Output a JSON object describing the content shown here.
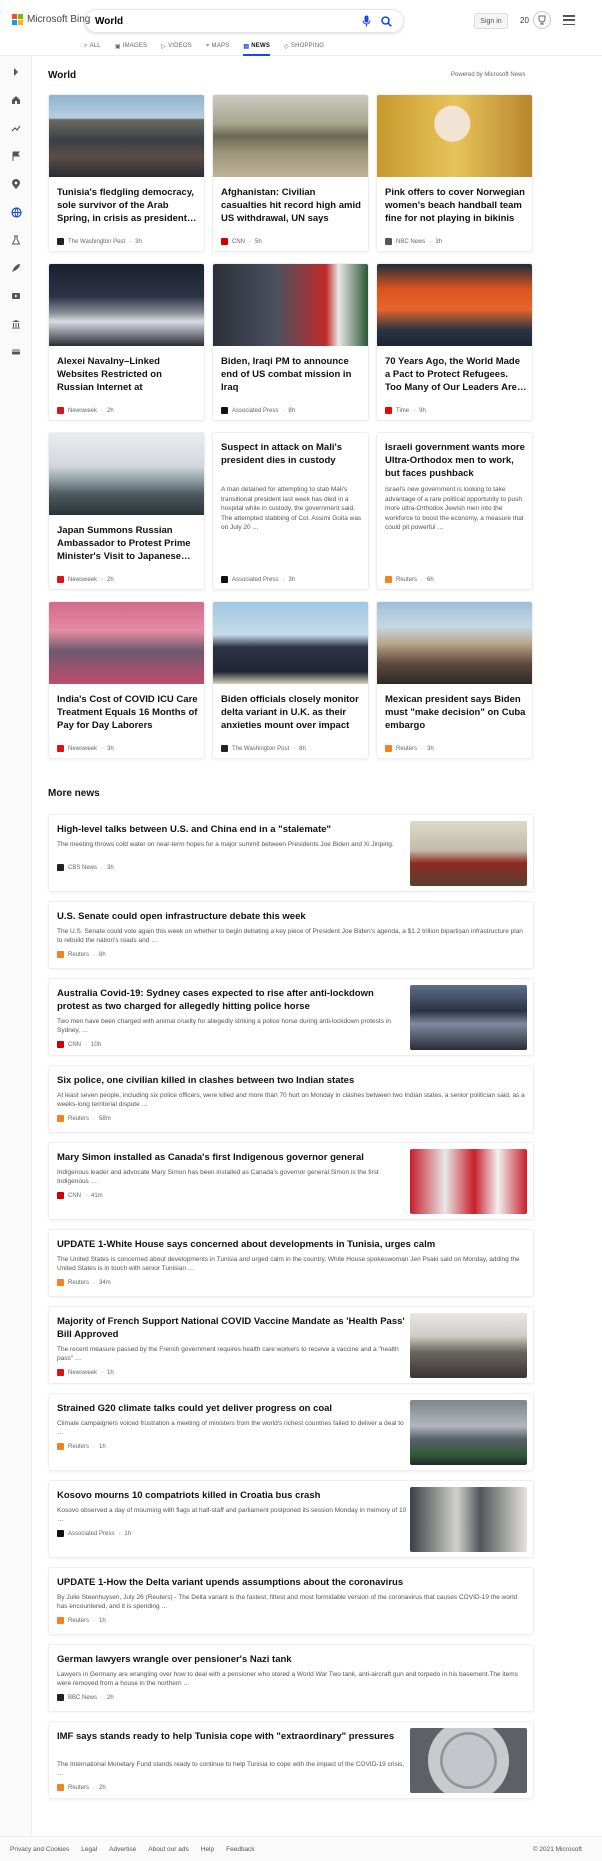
{
  "header": {
    "brand": "Microsoft Bing",
    "search_value": "World",
    "signin": "Sign in",
    "rewards_count": "20"
  },
  "scopes": [
    {
      "label": "ALL",
      "icon": "search-icon"
    },
    {
      "label": "IMAGES",
      "icon": "image-icon"
    },
    {
      "label": "VIDEOS",
      "icon": "video-icon"
    },
    {
      "label": "MAPS",
      "icon": "map-pin-icon"
    },
    {
      "label": "NEWS",
      "icon": "news-icon"
    },
    {
      "label": "SHOPPING",
      "icon": "tag-icon"
    }
  ],
  "sidebar_icons": [
    "expand-icon",
    "home-icon",
    "trending-icon",
    "flag-icon",
    "location-icon",
    "globe-icon",
    "science-icon",
    "rocket-icon",
    "entertainment-icon",
    "government-icon",
    "money-icon"
  ],
  "page": {
    "title": "World",
    "powered_by": "Powered by Microsoft News"
  },
  "cards": [
    {
      "title": "Tunisia's fledgling democracy, sole survivor of the Arab Spring, in crisis as president…",
      "source": "The Washington Post",
      "age": "3h",
      "logo_color": "#222",
      "scene": "crowd"
    },
    {
      "title": "Afghanistan: Civilian casualties hit record high amid US withdrawal, UN says",
      "source": "CNN",
      "age": "5h",
      "logo_color": "#cc0000",
      "scene": "military"
    },
    {
      "title": "Pink offers to cover Norwegian women's beach handball team fine for not playing in bikinis",
      "source": "NBC News",
      "age": "3h",
      "logo_color": "#555",
      "scene": "portrait-gold"
    },
    {
      "title": "Alexei Navalny–Linked Websites Restricted on Russian Internet at Government's…",
      "source": "Newsweek",
      "age": "2h",
      "logo_color": "#d7141a",
      "scene": "protest"
    },
    {
      "title": "Biden, Iraqi PM to announce end of US combat mission in Iraq",
      "source": "Associated Press",
      "age": "8h",
      "logo_color": "#111",
      "scene": "official"
    },
    {
      "title": "70 Years Ago, the World Made a Pact to Protect Refugees. Too Many of Our Leaders Are…",
      "source": "Time",
      "age": "9h",
      "logo_color": "#e90606",
      "scene": "boat"
    },
    {
      "title": "Japan Summons Russian Ambassador to Protest Prime Minister's Visit to Japanese…",
      "source": "Newsweek",
      "age": "2h",
      "logo_color": "#d7141a",
      "scene": "train"
    },
    {
      "title": "Suspect in attack on Mali's president dies in custody",
      "snippet": "A man detained for attempting to stab Mali's transitional president last week has died in a hospital while in custody, the government said. The attempted stabbing of Col. Assimi Goita was on July 20 …",
      "source": "Associated Press",
      "age": "3h",
      "logo_color": "#111",
      "scene": ""
    },
    {
      "title": "Israeli government wants more Ultra-Orthodox men to work, but faces pushback",
      "snippet": "Israel's new government is looking to take advantage of a rare political opportunity to push more ultra-Orthodox Jewish men into the workforce to boost the economy, a measure that could pit powerful …",
      "source": "Reuters",
      "age": "6h",
      "logo_color": "#f58220",
      "scene": ""
    },
    {
      "title": "India's Cost of COVID ICU Care Treatment Equals 16 Months of Pay for Day Laborers",
      "source": "Newsweek",
      "age": "3h",
      "logo_color": "#d7141a",
      "scene": "hospital"
    },
    {
      "title": "Biden officials closely monitor delta variant in U.K. as their anxieties mount over impact t…",
      "source": "The Washington Post",
      "age": "8h",
      "logo_color": "#222",
      "scene": "leaders"
    },
    {
      "title": "Mexican president says Biden must \"make decision\" on Cuba embargo",
      "source": "Reuters",
      "age": "3h",
      "logo_color": "#f58220",
      "scene": "plaza"
    }
  ],
  "more_news": {
    "heading": "More news",
    "items": [
      {
        "title": "High-level talks between U.S. and China end in a \"stalemate\"",
        "snippet": "The meeting throws cold water on near-term hopes for a major summit between Presidents Joe Biden and Xi Jinping.",
        "source": "CBS News",
        "age": "3h",
        "logo_color": "#222",
        "has_image": true,
        "scene": "meeting-room"
      },
      {
        "title": "U.S. Senate could open infrastructure debate this week",
        "snippet": "The U.S. Senate could vote again this week on whether to begin debating a key piece of President Joe Biden's agenda, a $1.2 trillion bipartisan infrastructure plan to rebuild the nation's roads and …",
        "source": "Reuters",
        "age": "8h",
        "logo_color": "#f58220",
        "has_image": false
      },
      {
        "title": "Australia Covid-19: Sydney cases expected to rise after anti-lockdown protest as two charged for allegedly hitting police horse",
        "snippet": "Two men have been charged with animal cruelty for allegedly striking a police horse during anti-lockdown protests in Sydney, …",
        "source": "CNN",
        "age": "10h",
        "logo_color": "#cc0000",
        "has_image": true,
        "scene": "street-protest"
      },
      {
        "title": "Six police, one civilian killed in clashes between two Indian states",
        "snippet": "At least seven people, including six police officers, were killed and more than 70 hurt on Monday in clashes between two Indian states, a senior politician said, as a weeks-long territorial dispute …",
        "source": "Reuters",
        "age": "58m",
        "logo_color": "#f58220",
        "has_image": false
      },
      {
        "title": "Mary Simon installed as Canada's first Indigenous governor general",
        "snippet": "Indigenous leader and advocate Mary Simon has been installed as Canada's governor general.Simon is the first Indigenous …",
        "source": "CNN",
        "age": "41m",
        "logo_color": "#cc0000",
        "has_image": true,
        "scene": "canada"
      },
      {
        "title": "UPDATE 1-White House says concerned about developments in Tunisia, urges calm",
        "snippet": "The United States is concerned about developments in Tunisia and urged calm in the country, White House spokeswoman Jen Psaki said on Monday, adding the United States is in touch with senior Tunisian …",
        "source": "Reuters",
        "age": "34m",
        "logo_color": "#f58220",
        "has_image": false
      },
      {
        "title": "Majority of French Support National COVID Vaccine Mandate as 'Health Pass' Bill Approved",
        "snippet": "The recent measure passed by the French government requires health care workers to receive a vaccine and a \"health pass\" …",
        "source": "Newsweek",
        "age": "1h",
        "logo_color": "#d7141a",
        "has_image": true,
        "scene": "french-protest"
      },
      {
        "title": "Strained G20 climate talks could yet deliver progress on coal",
        "snippet": "Climate campaigners voiced frustration a meeting of ministers from the world's richest countries failed to deliver a deal to …",
        "source": "Reuters",
        "age": "1h",
        "logo_color": "#f58220",
        "has_image": true,
        "scene": "steps"
      },
      {
        "title": "Kosovo mourns 10 compatriots killed in Croatia bus crash",
        "snippet": "Kosovo observed a day of mourning with flags at half-staff and parliament postponed its session Monday in memory of 10 …",
        "source": "Associated Press",
        "age": "1h",
        "logo_color": "#111",
        "has_image": true,
        "scene": "mourning"
      },
      {
        "title": "UPDATE 1-How the Delta variant upends assumptions about the coronavirus",
        "snippet": "By Julie Steenhuysen, July 26 (Reuters) - The Delta variant is the fastest, fittest and most formidable version of the coronavirus that causes COVID-19 the world has encountered, and it is spending …",
        "source": "Reuters",
        "age": "1h",
        "logo_color": "#f58220",
        "has_image": false
      },
      {
        "title": "German lawyers wrangle over pensioner's Nazi tank",
        "snippet": "Lawyers in Germany are wrangling over how to deal with a pensioner who stored a World War Two tank, anti-aircraft gun and torpedo in his basement.The items were removed from a house in the northern …",
        "source": "BBC News",
        "age": "2h",
        "logo_color": "#222",
        "has_image": false
      },
      {
        "title": "IMF says stands ready to help Tunisia cope with \"extraordinary\" pressures",
        "snippet": "The International Monetary Fund stands ready to continue to help Tunisia to cope with the impact of the COVID-19 crisis, …",
        "source": "Reuters",
        "age": "2h",
        "logo_color": "#f58220",
        "has_image": true,
        "scene": "imf"
      }
    ]
  },
  "footer": {
    "links": [
      "Privacy and Cookies",
      "Legal",
      "Advertise",
      "About our ads",
      "Help",
      "Feedback"
    ],
    "copyright": "© 2021 Microsoft"
  }
}
